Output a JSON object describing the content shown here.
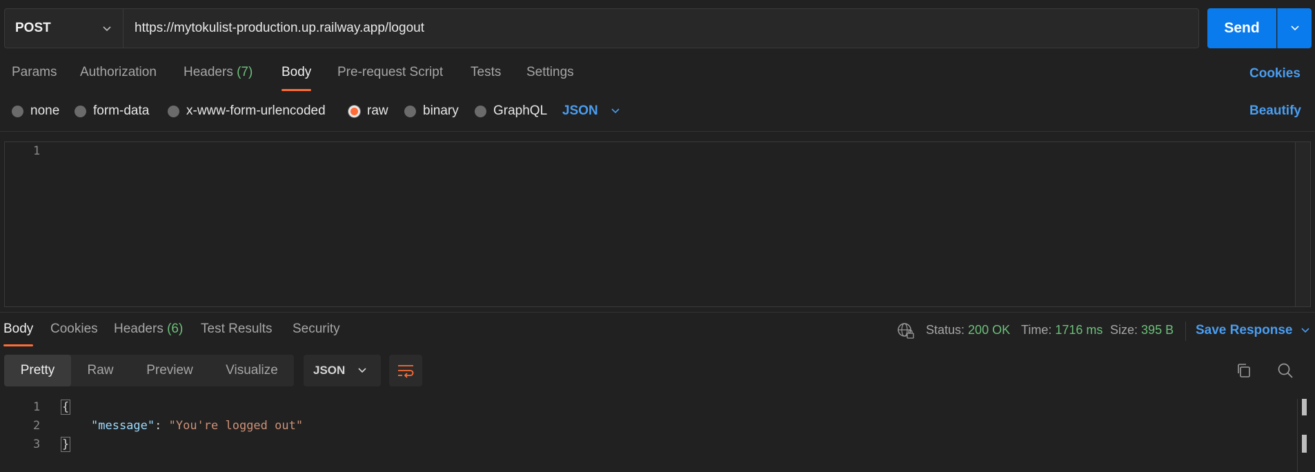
{
  "request": {
    "method": "POST",
    "url": "https://mytokulist-production.up.railway.app/logout",
    "send_label": "Send"
  },
  "req_tabs": [
    {
      "label": "Params"
    },
    {
      "label": "Authorization"
    },
    {
      "label": "Headers",
      "count": "(7)"
    },
    {
      "label": "Body"
    },
    {
      "label": "Pre-request Script"
    },
    {
      "label": "Tests"
    },
    {
      "label": "Settings"
    }
  ],
  "cookies_label": "Cookies",
  "body_types": [
    "none",
    "form-data",
    "x-www-form-urlencoded",
    "raw",
    "binary",
    "GraphQL"
  ],
  "selected_body_type": "raw",
  "body_lang": "JSON",
  "beautify_label": "Beautify",
  "editor": {
    "line_numbers": [
      "1"
    ]
  },
  "response": {
    "tabs": [
      {
        "label": "Body"
      },
      {
        "label": "Cookies"
      },
      {
        "label": "Headers",
        "count": "(6)"
      },
      {
        "label": "Test Results"
      },
      {
        "label": "Security"
      }
    ],
    "status_label": "Status:",
    "status_value": "200 OK",
    "time_label": "Time:",
    "time_value": "1716 ms",
    "size_label": "Size:",
    "size_value": "395 B",
    "save_label": "Save Response",
    "view_modes": [
      "Pretty",
      "Raw",
      "Preview",
      "Visualize"
    ],
    "format": "JSON",
    "line_numbers": [
      "1",
      "2",
      "3"
    ],
    "json": {
      "open": "{",
      "key": "\"message\"",
      "colon": ": ",
      "value": "\"You're logged out\"",
      "close": "}"
    }
  },
  "colors": {
    "accent": "#ff6c37",
    "send": "#097bed",
    "link": "#4a9df0",
    "ok": "#6cc07a"
  },
  "icons": [
    "chevron-down-icon",
    "globe-lock-icon",
    "wrap-lines-icon",
    "copy-icon",
    "search-icon"
  ]
}
